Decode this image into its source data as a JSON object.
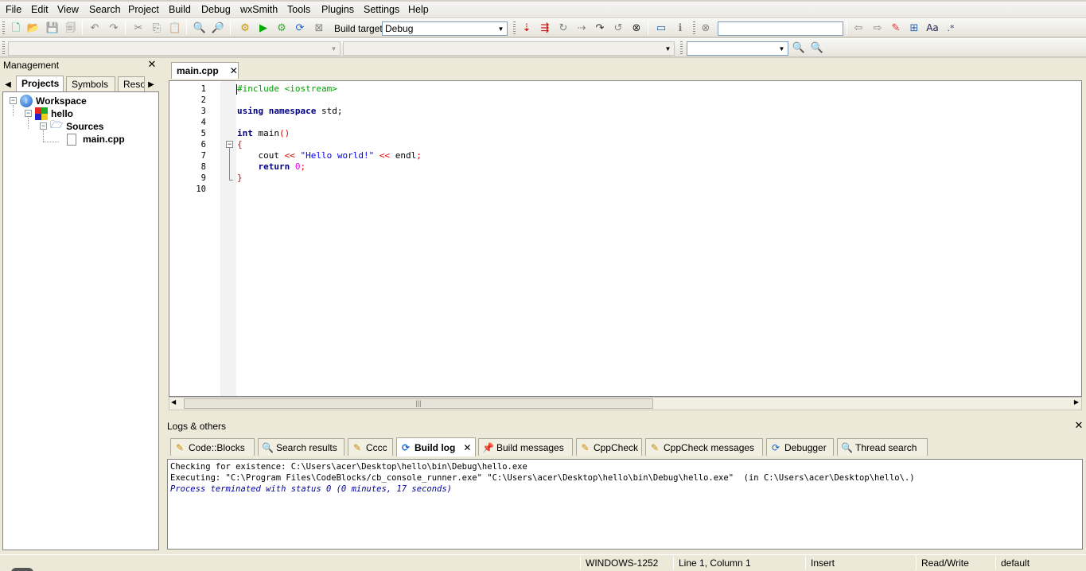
{
  "menu": [
    "File",
    "Edit",
    "View",
    "Search",
    "Project",
    "Build",
    "Debug",
    "wxSmith",
    "Tools",
    "Plugins",
    "Settings",
    "Help"
  ],
  "toolbar": {
    "build_target_label": "Build target:",
    "build_target_value": "Debug",
    "search_placeholder": ""
  },
  "management": {
    "title": "Management",
    "tabs": [
      "Projects",
      "Symbols",
      "Resources"
    ],
    "tree": {
      "workspace": "Workspace",
      "project": "hello",
      "folder": "Sources",
      "file": "main.cpp"
    }
  },
  "editor": {
    "tab_label": "main.cpp",
    "line_numbers": [
      "1",
      "2",
      "3",
      "4",
      "5",
      "6",
      "7",
      "8",
      "9",
      "10"
    ]
  },
  "logs": {
    "title": "Logs & others",
    "tabs": [
      "Code::Blocks",
      "Search results",
      "Cccc",
      "Build log",
      "Build messages",
      "CppCheck",
      "CppCheck messages",
      "Debugger",
      "Thread search"
    ],
    "lines": [
      "Checking for existence: C:\\Users\\acer\\Desktop\\hello\\bin\\Debug\\hello.exe",
      "Executing: \"C:\\Program Files\\CodeBlocks/cb_console_runner.exe\" \"C:\\Users\\acer\\Desktop\\hello\\bin\\Debug\\hello.exe\"  (in C:\\Users\\acer\\Desktop\\hello\\.)",
      "Process terminated with status 0 (0 minutes, 17 seconds)"
    ]
  },
  "status": {
    "encoding": "WINDOWS-1252",
    "position": "Line 1, Column 1",
    "mode": "Insert",
    "access": "Read/Write",
    "profile": "default"
  },
  "colors": {
    "keyword": "#00007f",
    "preprocessor": "#00a000",
    "operator": "#e00000",
    "string": "#0000ff",
    "number": "#f000f0",
    "log_status": "#0000a0"
  }
}
